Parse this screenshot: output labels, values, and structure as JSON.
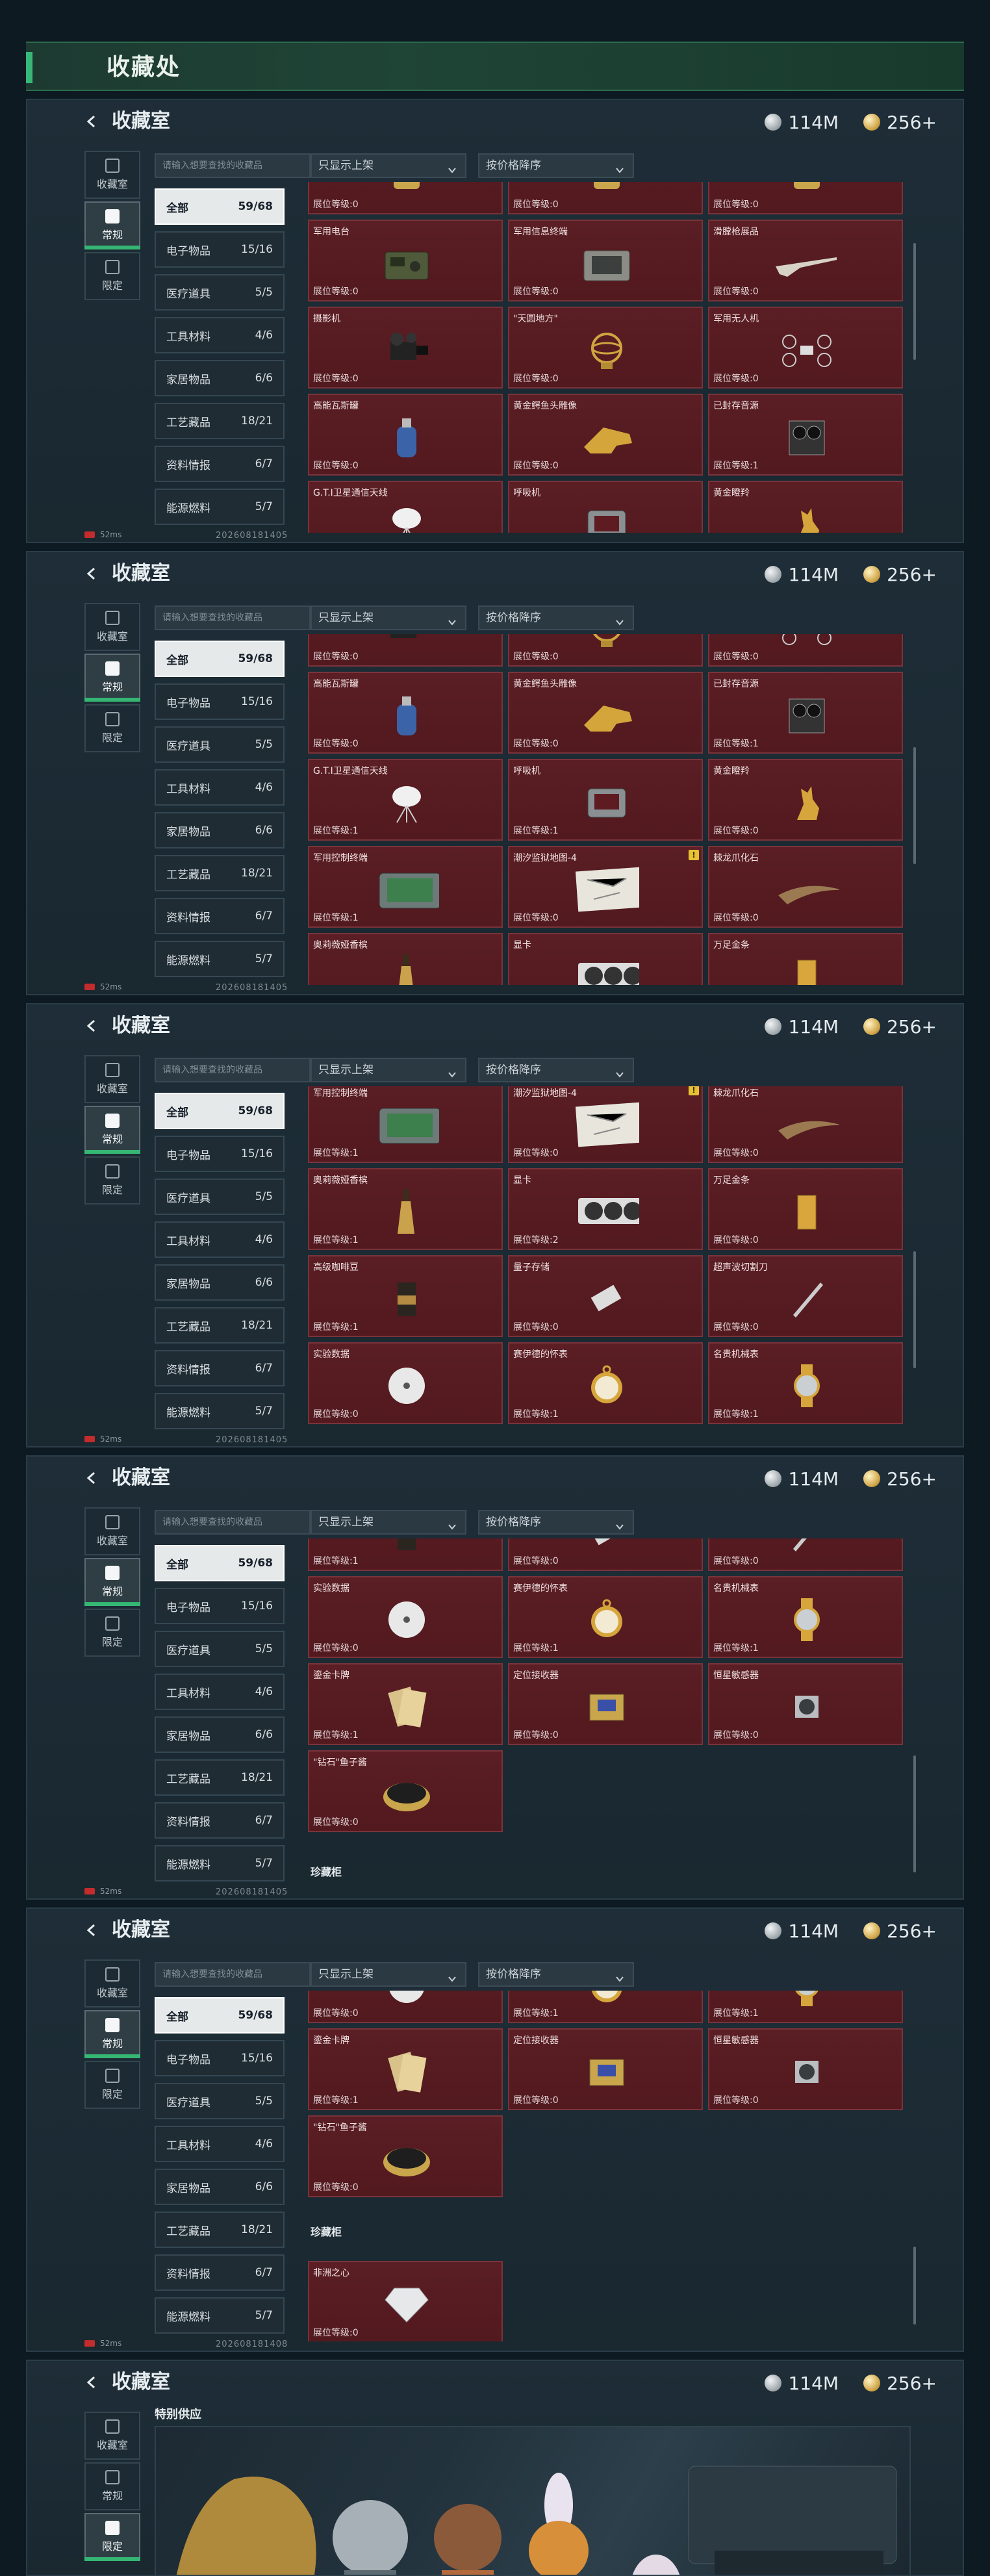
{
  "page": {
    "title": "收藏处",
    "room_title": "收藏室",
    "currency": {
      "silver": "114M",
      "gold": "256+"
    },
    "side_tabs": [
      "收藏室",
      "常规",
      "限定"
    ],
    "search_placeholder": "请输入想要查找的收藏品",
    "filter": "只显示上架",
    "sort": "按价格降序",
    "footer_ping": "52ms",
    "watermark": "2026081814 05",
    "watermark2": "202608181405",
    "watermark3": "202608181408"
  },
  "categories": [
    {
      "label": "全部",
      "count": "59/68"
    },
    {
      "label": "电子物品",
      "count": "15/16"
    },
    {
      "label": "医疗道具",
      "count": "5/5"
    },
    {
      "label": "工具材料",
      "count": "4/6"
    },
    {
      "label": "家居物品",
      "count": "6/6"
    },
    {
      "label": "工艺藏品",
      "count": "18/21"
    },
    {
      "label": "资料情报",
      "count": "6/7"
    },
    {
      "label": "能源燃料",
      "count": "5/7"
    }
  ],
  "level_label": "展位等级:",
  "items": [
    {
      "name": "",
      "level": "0"
    },
    {
      "name": "",
      "level": "0"
    },
    {
      "name": "",
      "level": "0"
    },
    {
      "name": "军用电台",
      "level": "0"
    },
    {
      "name": "军用信息终端",
      "level": "0"
    },
    {
      "name": "滑膛枪展品",
      "level": "0"
    },
    {
      "name": "摄影机",
      "level": "0"
    },
    {
      "name": "\"天圆地方\"",
      "level": "0"
    },
    {
      "name": "军用无人机",
      "level": "0"
    },
    {
      "name": "高能瓦斯罐",
      "level": "0"
    },
    {
      "name": "黄金鳄鱼头雕像",
      "level": "0"
    },
    {
      "name": "已封存音源",
      "level": "1"
    },
    {
      "name": "G.T.I卫星通信天线",
      "level": "1"
    },
    {
      "name": "呼吸机",
      "level": "1"
    },
    {
      "name": "黄金瞪羚",
      "level": "0"
    },
    {
      "name": "军用控制终端",
      "level": "1"
    },
    {
      "name": "潮汐监狱地图-4",
      "level": "0"
    },
    {
      "name": "棘龙爪化石",
      "level": "0"
    },
    {
      "name": "奥莉薇娅香槟",
      "level": "1"
    },
    {
      "name": "显卡",
      "level": "2"
    },
    {
      "name": "万足金条",
      "level": "0"
    },
    {
      "name": "高级咖啡豆",
      "level": "1"
    },
    {
      "name": "量子存储",
      "level": "0"
    },
    {
      "name": "超声波切割刀",
      "level": "0"
    },
    {
      "name": "实验数据",
      "level": "0"
    },
    {
      "name": "赛伊德的怀表",
      "level": "1"
    },
    {
      "name": "名贵机械表",
      "level": "1"
    },
    {
      "name": "鎏金卡牌",
      "level": "1"
    },
    {
      "name": "定位接收器",
      "level": "0"
    },
    {
      "name": "恒星敏感器",
      "level": "0"
    },
    {
      "name": "\"钻石\"鱼子酱",
      "level": "0"
    },
    {
      "name": "非洲之心",
      "level": "0"
    }
  ],
  "sections": {
    "treasure": "珍藏柜",
    "special": "特别供应"
  }
}
